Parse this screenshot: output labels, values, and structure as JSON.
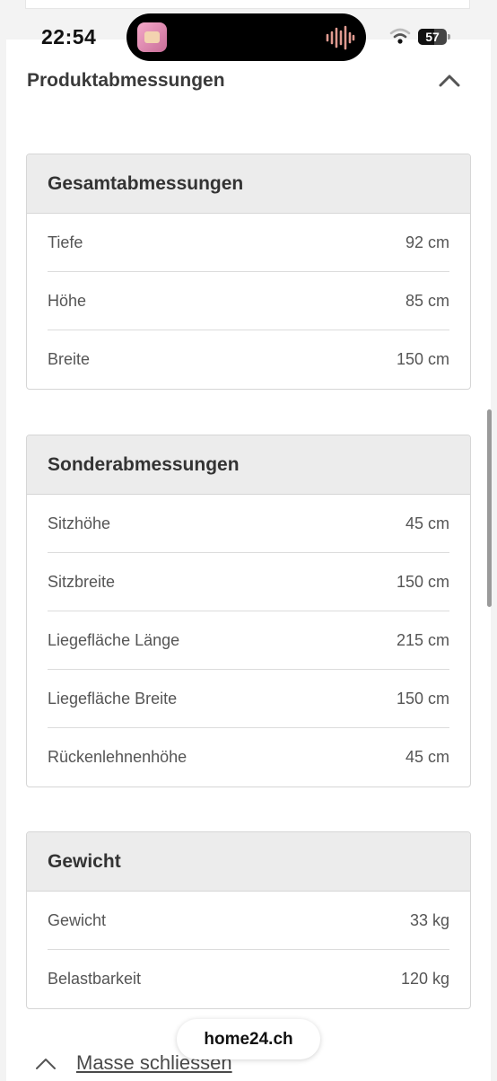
{
  "status_bar": {
    "time": "22:54",
    "battery": "57",
    "battery_level": 0.57,
    "icons": [
      "app-thumbnail-icon",
      "audio-waveform-icon",
      "wifi-icon",
      "battery-icon"
    ]
  },
  "section": {
    "title": "Produktabmessungen",
    "toggle_icon": "chevron-up-icon"
  },
  "cards": {
    "overall": {
      "title": "Gesamtabmessungen",
      "rows": [
        {
          "label": "Tiefe",
          "value": "92 cm"
        },
        {
          "label": "Höhe",
          "value": "85 cm"
        },
        {
          "label": "Breite",
          "value": "150 cm"
        }
      ]
    },
    "special": {
      "title": "Sonderabmessungen",
      "rows": [
        {
          "label": "Sitzhöhe",
          "value": "45 cm"
        },
        {
          "label": "Sitzbreite",
          "value": "150 cm"
        },
        {
          "label": "Liegefläche Länge",
          "value": "215 cm"
        },
        {
          "label": "Liegefläche Breite",
          "value": "150 cm"
        },
        {
          "label": "Rückenlehnenhöhe",
          "value": "45 cm"
        }
      ]
    },
    "weight": {
      "title": "Gewicht",
      "rows": [
        {
          "label": "Gewicht",
          "value": "33 kg"
        },
        {
          "label": "Belastbarkeit",
          "value": "120 kg"
        }
      ]
    }
  },
  "footer": {
    "close_label": "Masse schliessen",
    "close_icon": "chevron-up-icon"
  },
  "browser": {
    "url": "home24.ch"
  },
  "colors": {
    "card_header_bg": "#ececec",
    "border": "#d6d6d6",
    "text": "#333333",
    "background": "#f3f3f3"
  }
}
